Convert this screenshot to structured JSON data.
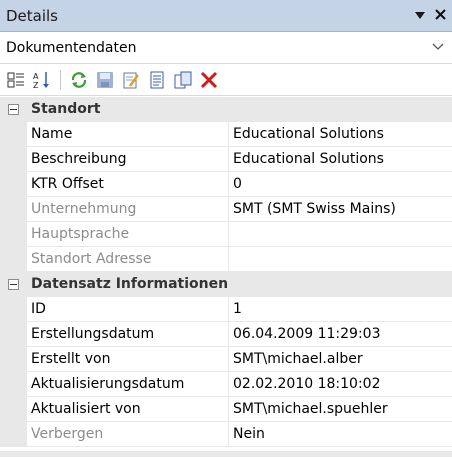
{
  "window": {
    "title": "Details"
  },
  "dropdown": {
    "value": "Dokumentendaten"
  },
  "toolbar": {
    "icons": [
      "categorized-icon",
      "sort-alpha-icon",
      "refresh-icon",
      "save-icon",
      "edit-icon",
      "document-icon",
      "copy-icon",
      "delete-icon"
    ]
  },
  "categories": [
    {
      "label": "Standort",
      "props": [
        {
          "name": "Name",
          "value": "Educational Solutions"
        },
        {
          "name": "Beschreibung",
          "value": "Educational Solutions"
        },
        {
          "name": "KTR Offset",
          "value": "0"
        },
        {
          "name": "Unternehmung",
          "value": "SMT (SMT Swiss Mains)"
        },
        {
          "name": "Hauptsprache",
          "value": ""
        },
        {
          "name": "Standort Adresse",
          "value": ""
        }
      ]
    },
    {
      "label": "Datensatz Informationen",
      "props": [
        {
          "name": "ID",
          "value": "1"
        },
        {
          "name": "Erstellungsdatum",
          "value": "06.04.2009 11:29:03"
        },
        {
          "name": "Erstellt von",
          "value": "SMT\\michael.alber"
        },
        {
          "name": "Aktualisierungsdatum",
          "value": "02.02.2010 18:10:02"
        },
        {
          "name": "Aktualisiert von",
          "value": "SMT\\michael.spuehler"
        },
        {
          "name": "Verbergen",
          "value": "Nein"
        }
      ]
    }
  ],
  "colors": {
    "titlebar": "#c5d3e6",
    "category_bg": "#e8e8e8",
    "disabled_text": "#8c8c8c",
    "delete_red": "#d21a1a"
  }
}
